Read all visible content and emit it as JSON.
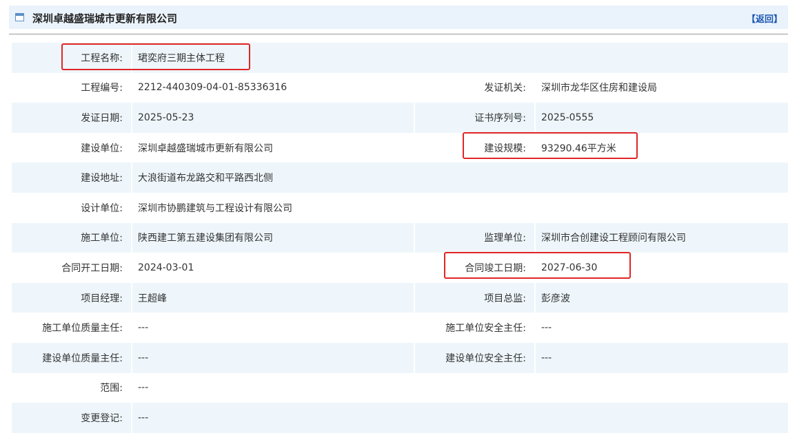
{
  "header": {
    "icon": "window-icon",
    "title": "深圳卓越盛瑞城市更新有限公司",
    "back_label": "【返回】"
  },
  "rows": [
    {
      "left_label": "工程名称:",
      "left_value": "珺奕府三期主体工程",
      "right_label": "",
      "right_value": ""
    },
    {
      "left_label": "工程编号:",
      "left_value": "2212-440309-04-01-85336316",
      "right_label": "发证机关:",
      "right_value": "深圳市龙华区住房和建设局"
    },
    {
      "left_label": "发证日期:",
      "left_value": "2025-05-23",
      "right_label": "证书序列号:",
      "right_value": "2025-0555"
    },
    {
      "left_label": "建设单位:",
      "left_value": "深圳卓越盛瑞城市更新有限公司",
      "right_label": "建设规模:",
      "right_value": "93290.46平方米"
    },
    {
      "left_label": "建设地址:",
      "left_value": "大浪街道布龙路交和平路西北侧",
      "right_label": "",
      "right_value": ""
    },
    {
      "left_label": "设计单位:",
      "left_value": "深圳市协鹏建筑与工程设计有限公司",
      "right_label": "",
      "right_value": ""
    },
    {
      "left_label": "施工单位:",
      "left_value": "陕西建工第五建设集团有限公司",
      "right_label": "监理单位:",
      "right_value": "深圳市合创建设工程顾问有限公司"
    },
    {
      "left_label": "合同开工日期:",
      "left_value": "2024-03-01",
      "right_label": "合同竣工日期:",
      "right_value": "2027-06-30"
    },
    {
      "left_label": "项目经理:",
      "left_value": "王超峰",
      "right_label": "项目总监:",
      "right_value": "彭彦波"
    },
    {
      "left_label": "施工单位质量主任:",
      "left_value": "---",
      "right_label": "施工单位安全主任:",
      "right_value": "---"
    },
    {
      "left_label": "建设单位质量主任:",
      "left_value": "---",
      "right_label": "建设单位安全主任:",
      "right_value": "---"
    },
    {
      "left_label": "范围:",
      "left_value": "---",
      "right_label": "",
      "right_value": ""
    },
    {
      "left_label": "变更登记:",
      "left_value": "---",
      "right_label": "",
      "right_value": ""
    }
  ],
  "colors": {
    "header_bg": "#eaf3fb",
    "row_shade": "#eef6fb",
    "highlight": "#e02424",
    "link": "#1a56b3"
  }
}
